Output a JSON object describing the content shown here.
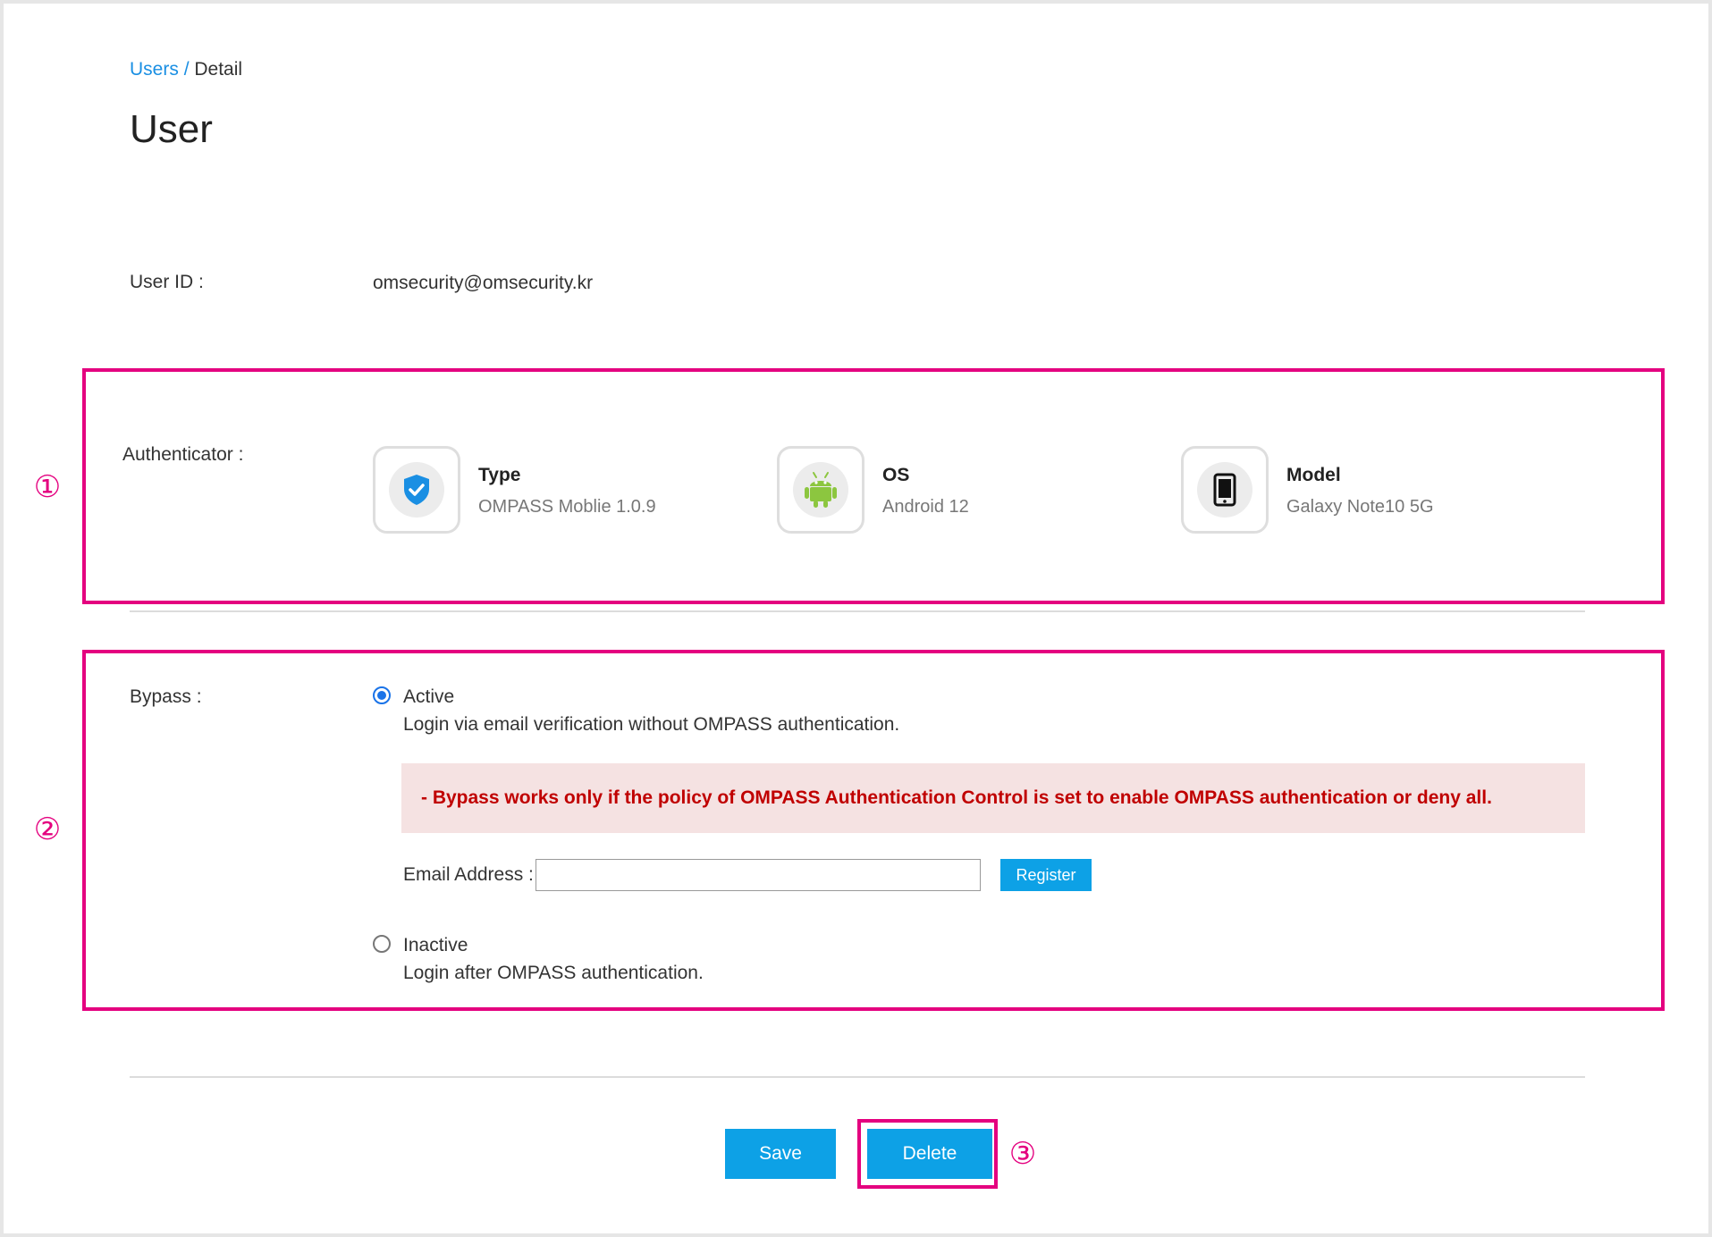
{
  "breadcrumb": {
    "parent": "Users",
    "separator": "/",
    "current": "Detail"
  },
  "page": {
    "title": "User"
  },
  "user_id": {
    "label": "User ID :",
    "value": "omsecurity@omsecurity.kr"
  },
  "authenticator": {
    "label": "Authenticator :",
    "cards": [
      {
        "title": "Type",
        "value": "OMPASS Moblie 1.0.9",
        "icon": "shield-check-icon"
      },
      {
        "title": "OS",
        "value": "Android 12",
        "icon": "android-icon"
      },
      {
        "title": "Model",
        "value": "Galaxy Note10 5G",
        "icon": "smartphone-icon"
      }
    ]
  },
  "bypass": {
    "label": "Bypass :",
    "active": {
      "label": "Active",
      "description": "Login via email verification without OMPASS authentication.",
      "selected": true
    },
    "warning": "- Bypass works only if the policy of OMPASS Authentication Control is set to enable OMPASS authentication or deny all.",
    "email": {
      "label": "Email Address :",
      "value": "",
      "placeholder": ""
    },
    "register_label": "Register",
    "inactive": {
      "label": "Inactive",
      "description": "Login after OMPASS authentication.",
      "selected": false
    }
  },
  "actions": {
    "save_label": "Save",
    "delete_label": "Delete"
  },
  "markers": {
    "one": "①",
    "two": "②",
    "three": "③"
  },
  "colors": {
    "accent": "#0da1e6",
    "highlight": "#e4007f",
    "warning_text": "#c00000",
    "warning_bg": "#f5e2e2",
    "link": "#1a8fe3"
  }
}
